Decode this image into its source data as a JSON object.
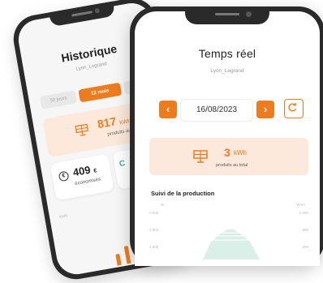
{
  "back_screen": {
    "title": "Historique",
    "subtitle": "Lyon_Legrand",
    "period_tabs": [
      "30 jours",
      "12 mois",
      ""
    ],
    "energy": {
      "value": "817",
      "unit": "kWh",
      "label": "produits au total"
    },
    "savings": {
      "value": "409",
      "unit": "€",
      "label": "économisés"
    },
    "co2": {
      "value": "C"
    },
    "chart_ticks": [
      "kWh",
      "",
      ""
    ]
  },
  "front_screen": {
    "title": "Temps réel",
    "subtitle": "Lyon_Legrand",
    "date": "16/08/2023",
    "prev_label": "‹",
    "next_label": "›",
    "production": {
      "value": "3",
      "unit": "kWh",
      "label": "produits au total"
    },
    "section_title": "Suivi de la production",
    "chart": {
      "unit_left": "W",
      "unit_right": "W/m²",
      "ticks_left": [
        "2 500",
        "2 000",
        "1 500"
      ],
      "ticks_right": [
        "1 000",
        "800",
        "600"
      ]
    }
  },
  "colors": {
    "accent": "#ec7c1e",
    "accent_light": "#fde9db",
    "green": "#35b39a"
  }
}
